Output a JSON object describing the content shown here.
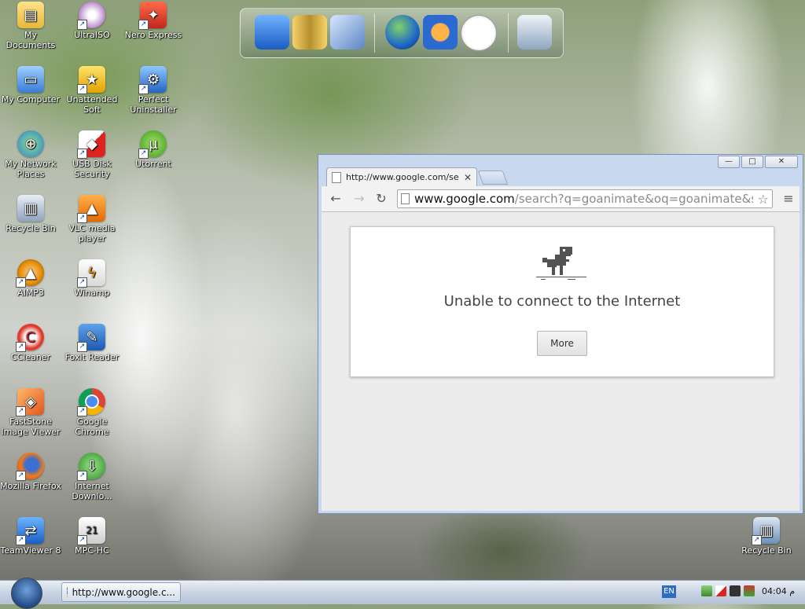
{
  "desktop": {
    "icons": [
      {
        "label": "My Documents",
        "icon": "folder-documents-icon"
      },
      {
        "label": "UltraISO",
        "icon": "disc-icon"
      },
      {
        "label": "Nero Express",
        "icon": "nero-icon"
      },
      {
        "label": "My Computer",
        "icon": "computer-icon"
      },
      {
        "label": "Unattended Soft",
        "icon": "star-icon"
      },
      {
        "label": "Perfect Uninstaller",
        "icon": "uninstaller-icon"
      },
      {
        "label": "My Network Places",
        "icon": "network-icon"
      },
      {
        "label": "USB Disk Security",
        "icon": "usb-shield-icon"
      },
      {
        "label": "Utorrent",
        "icon": "utorrent-icon"
      },
      {
        "label": "Recycle Bin",
        "icon": "recycle-bin-icon"
      },
      {
        "label": "VLC media player",
        "icon": "vlc-icon"
      },
      {
        "label": "AIMP3",
        "icon": "aimp-icon"
      },
      {
        "label": "Winamp",
        "icon": "winamp-icon"
      },
      {
        "label": "CCleaner",
        "icon": "ccleaner-icon"
      },
      {
        "label": "Foxit Reader",
        "icon": "foxit-icon"
      },
      {
        "label": "FastStone Image Viewer",
        "icon": "faststone-icon"
      },
      {
        "label": "Google Chrome",
        "icon": "chrome-icon"
      },
      {
        "label": "Mozilla Firefox",
        "icon": "firefox-icon"
      },
      {
        "label": "Internet Downlo...",
        "icon": "idm-icon"
      },
      {
        "label": "TeamViewer 8",
        "icon": "teamviewer-icon"
      },
      {
        "label": "MPC-HC",
        "icon": "mpc-icon"
      },
      {
        "label": "Recycle Bin",
        "icon": "recycle-bin-icon"
      }
    ]
  },
  "dock": {
    "items": [
      "monitor-icon",
      "folders-icon",
      "disk-icon",
      "globe-icon",
      "media-player-icon",
      "clock-icon",
      "trash-icon"
    ]
  },
  "browser": {
    "tab_title": "http://www.google.com/sear",
    "url_host": "www.google.com",
    "url_rest": "/search?q=goanimate&oq=goanimate&sou",
    "error_title": "Unable to connect to the Internet",
    "more_label": "More",
    "controls": {
      "minimize": "—",
      "maximize": "□",
      "close": "✕"
    }
  },
  "taskbar": {
    "task_label": "http://www.google.c...",
    "language": "EN",
    "clock": "04:04 م"
  }
}
